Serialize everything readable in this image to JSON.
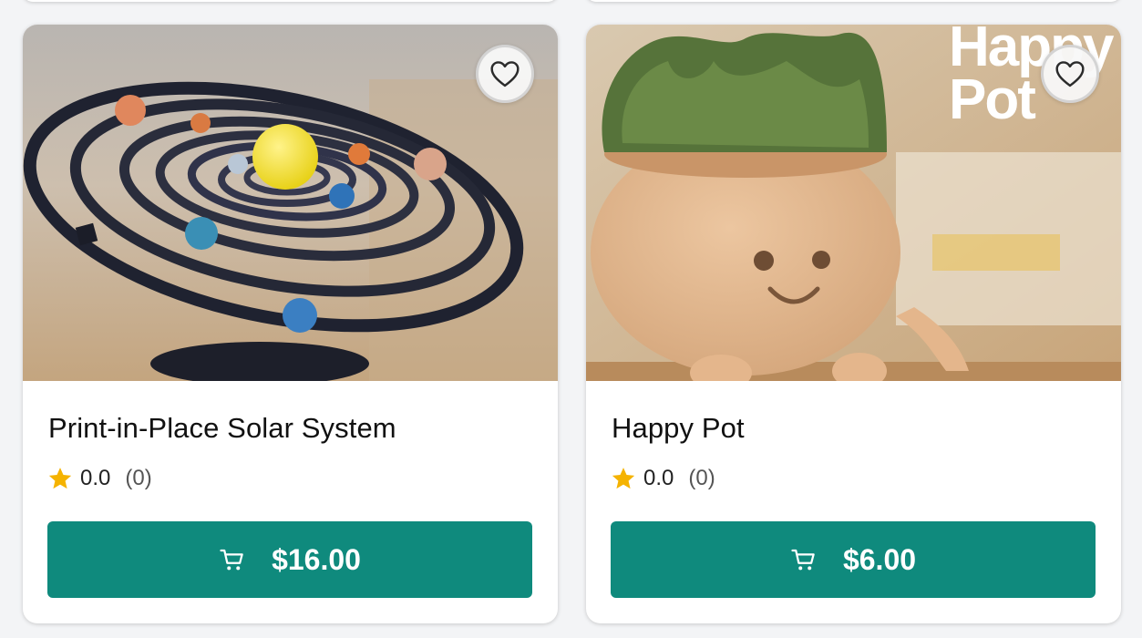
{
  "products": [
    {
      "title": "Print-in-Place Solar System",
      "rating": "0.0",
      "review_count": "(0)",
      "price": "$16.00",
      "favorite_icon": "heart-outline-icon",
      "cart_icon": "cart-icon"
    },
    {
      "title": "Happy Pot",
      "rating": "0.0",
      "review_count": "(0)",
      "price": "$6.00",
      "image_overlay_text": [
        "Happy",
        "Pot"
      ],
      "favorite_icon": "heart-outline-icon",
      "cart_icon": "cart-icon"
    }
  ],
  "colors": {
    "button": "#0f8a7d",
    "star": "#f5b301",
    "text": "#111111"
  }
}
